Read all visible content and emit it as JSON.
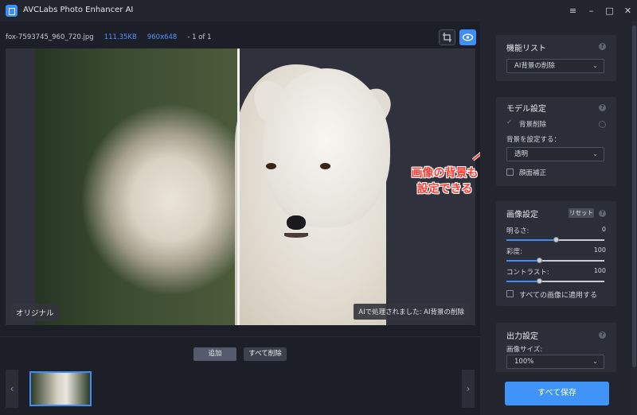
{
  "app": {
    "title": "AVCLabs Photo Enhancer AI",
    "window_controls": {
      "menu": "≡",
      "minimize": "–",
      "maximize": "□",
      "close": "✕"
    }
  },
  "file_info": {
    "name": "fox-7593745_960_720.jpg",
    "size": "111.35KB",
    "dimensions": "960x648",
    "page": "- 1 of 1"
  },
  "preview": {
    "label_original": "オリジナル",
    "label_processed": "AIで処理されました: AI背景の削除"
  },
  "thumbs": {
    "add_label": "追加",
    "delete_all_label": "すべて削除",
    "prev": "‹",
    "next": "›"
  },
  "sidebar": {
    "features": {
      "title": "機能リスト",
      "selected": "AI背景の削除"
    },
    "model": {
      "title": "モデル設定",
      "bg_remove_label": "背景削除",
      "bg_remove_checked": true,
      "set_bg_label": "背景を設定する：",
      "bg_selected": "透明",
      "face_fix_label": "顔面補正",
      "face_fix_checked": false
    },
    "image": {
      "title": "画像設定",
      "reset_label": "リセット",
      "brightness_label": "明るさ:",
      "brightness_value": "0",
      "saturation_label": "彩度:",
      "saturation_value": "100",
      "contrast_label": "コントラスト:",
      "contrast_value": "100",
      "apply_all_label": "すべての画像に適用する"
    },
    "output": {
      "title": "出力設定",
      "size_label": "画像サイズ:",
      "size_selected": "100%"
    },
    "save_all_label": "すべて保存"
  },
  "annotation": {
    "line1": "画像の背景も",
    "line2": "設定できる",
    "color": "#ff3b30"
  },
  "colors": {
    "accent": "#3f8ef8",
    "background": "#1c1f27",
    "panel": "#2b2e38"
  },
  "icons": {
    "logo": "app-logo-icon",
    "crop": "crop-icon",
    "eye": "eye-icon",
    "help": "help-icon",
    "gear": "gear-icon",
    "chevron": "chevron-down-icon"
  }
}
